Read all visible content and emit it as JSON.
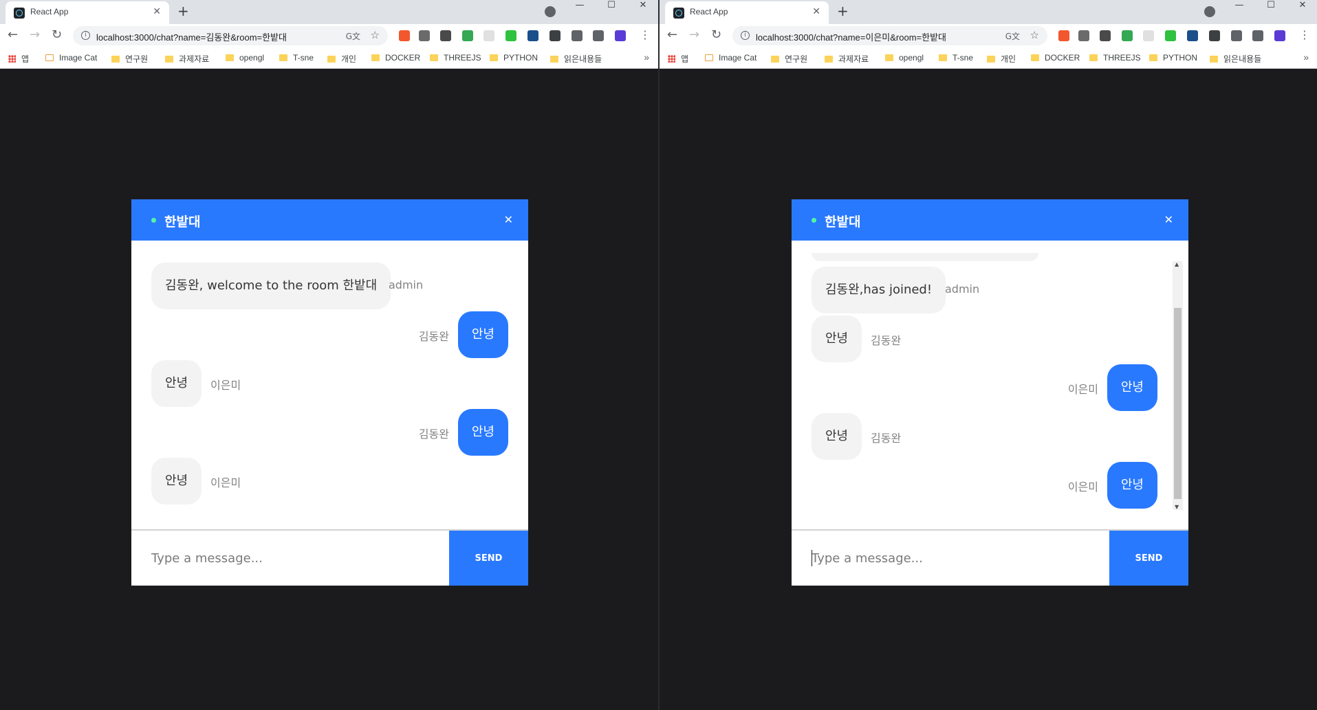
{
  "windows": [
    {
      "tab_title": "React App",
      "url": "localhost:3000/chat?name=김동완&room=한밭대",
      "bookmarks": [
        "앱",
        "Image Cat",
        "연구원",
        "과제자료",
        "opengl",
        "T-sne",
        "개인",
        "DOCKER",
        "THREEJS",
        "PYTHON",
        "읽은내용들"
      ],
      "chat": {
        "room": "한밭대",
        "close_glyph": "✕",
        "messages": [
          {
            "text": "김동완, welcome to the room 한밭대",
            "sender": "admin",
            "mine": false
          },
          {
            "text": "안녕",
            "sender": "김동완",
            "mine": true
          },
          {
            "text": "안녕",
            "sender": "이은미",
            "mine": false
          },
          {
            "text": "안녕",
            "sender": "김동완",
            "mine": true
          },
          {
            "text": "안녕",
            "sender": "이은미",
            "mine": false
          }
        ],
        "input_placeholder": "Type a message...",
        "send_label": "SEND"
      }
    },
    {
      "tab_title": "React App",
      "url": "localhost:3000/chat?name=이은미&room=한밭대",
      "bookmarks": [
        "앱",
        "Image Cat",
        "연구원",
        "과제자료",
        "opengl",
        "T-sne",
        "개인",
        "DOCKER",
        "THREEJS",
        "PYTHON",
        "읽은내용들"
      ],
      "chat": {
        "room": "한밭대",
        "close_glyph": "✕",
        "messages": [
          {
            "text": "김동완,has joined!",
            "sender": "admin",
            "mine": false
          },
          {
            "text": "안녕",
            "sender": "김동완",
            "mine": false
          },
          {
            "text": "안녕",
            "sender": "이은미",
            "mine": true
          },
          {
            "text": "안녕",
            "sender": "김동완",
            "mine": false
          },
          {
            "text": "안녕",
            "sender": "이은미",
            "mine": true
          }
        ],
        "input_placeholder": "Type a message...",
        "send_label": "SEND"
      }
    }
  ],
  "icons": {
    "back": "←",
    "forward": "→",
    "reload": "↻",
    "star": "☆",
    "new_tab": "+",
    "minimize": "—",
    "maximize": "☐",
    "close": "✕",
    "tab_close": "✕",
    "menu": "⋮",
    "more": "»",
    "info": "i",
    "translate": "G文"
  },
  "colors": {
    "accent": "#2979ff",
    "background": "#1b1b1d",
    "online_dot": "#54f5a3",
    "bubble_other": "#f3f3f3"
  }
}
